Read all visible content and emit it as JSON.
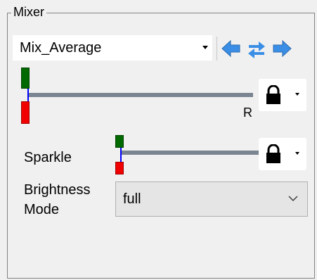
{
  "mixer": {
    "group_title": "Mixer",
    "mix_combo": {
      "value": "Mix_Average"
    },
    "nav": {
      "left_icon": "arrow-left-icon",
      "swap_icon": "swap-arrows-icon",
      "right_icon": "arrow-right-icon"
    },
    "main_slider": {
      "end_label": "R",
      "lock_icon": "lock-icon"
    },
    "sparkle": {
      "label": "Sparkle",
      "lock_icon": "lock-icon"
    },
    "brightness": {
      "label_line1": "Brightness",
      "label_line2": "Mode",
      "value": "full"
    }
  },
  "colors": {
    "marker_green": "#006a00",
    "marker_red": "#f00000",
    "track": "#7a8591",
    "accent_blue": "#3a8ee6"
  }
}
